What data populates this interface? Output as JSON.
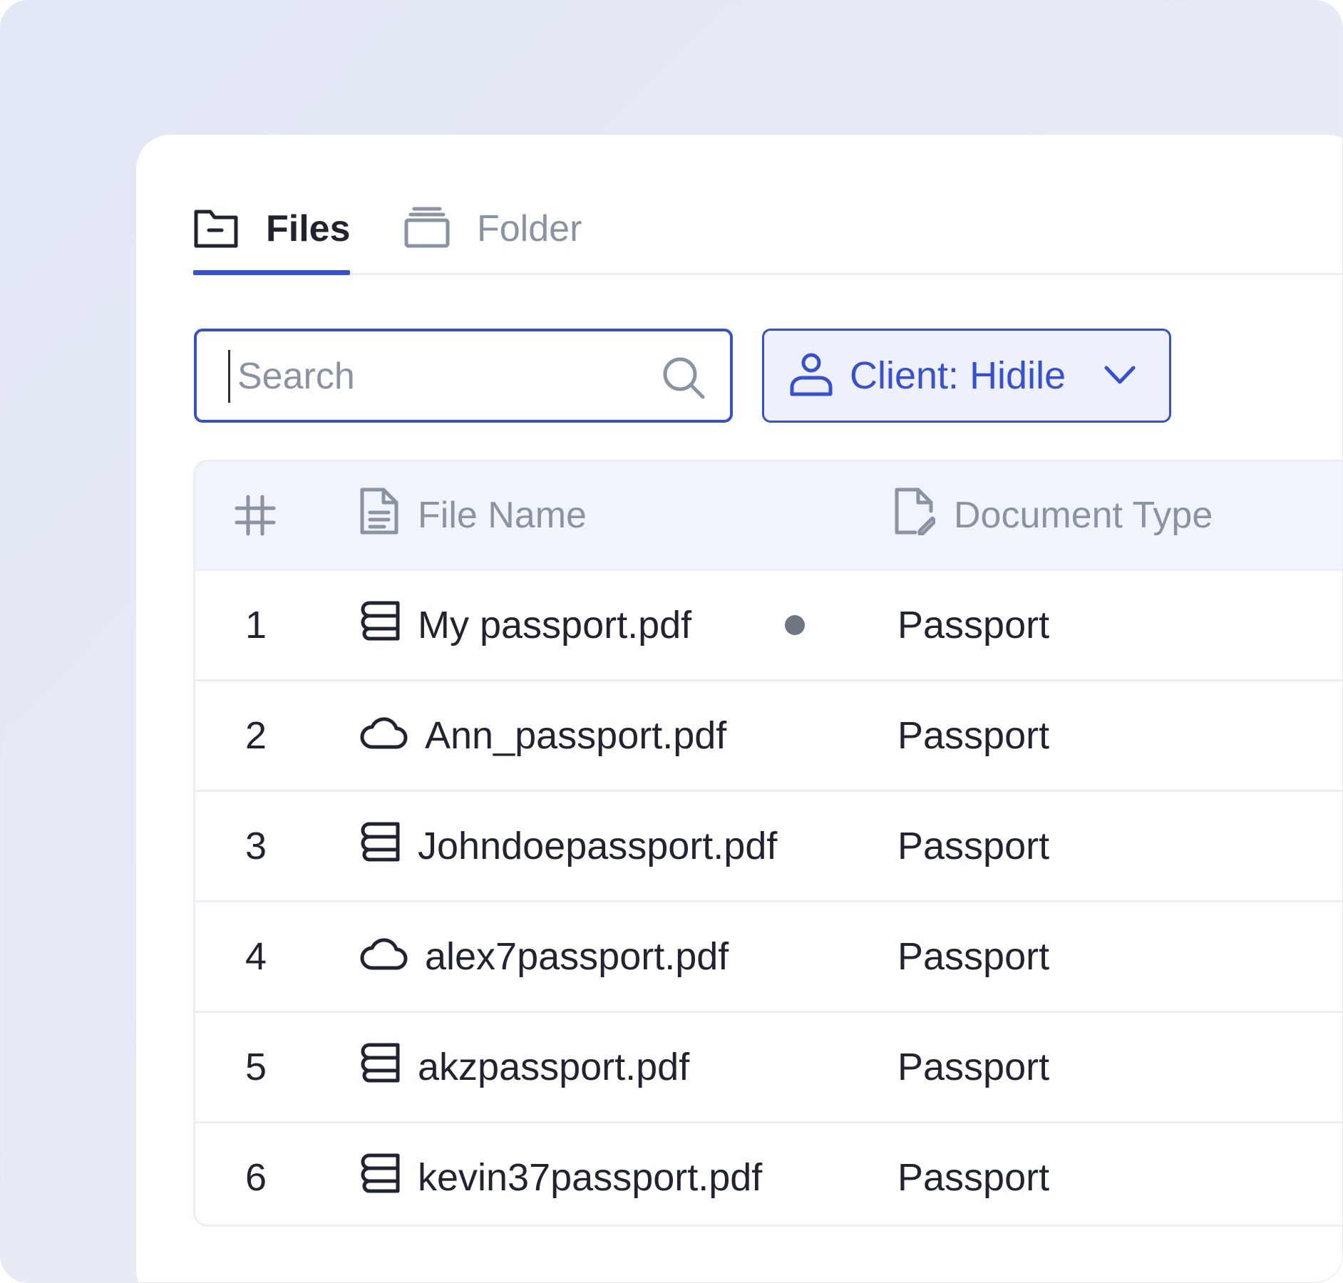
{
  "tabs": [
    {
      "label": "Files",
      "icon": "folder-icon",
      "active": true
    },
    {
      "label": "Folder",
      "icon": "stack-icon",
      "active": false
    }
  ],
  "search": {
    "placeholder": "Search",
    "value": ""
  },
  "client_filter": {
    "label": "Client: Hidile"
  },
  "table": {
    "headers": {
      "num": "#",
      "file_name": "File Name",
      "document_type": "Document Type"
    },
    "rows": [
      {
        "num": "1",
        "file_name": "My passport.pdf",
        "document_type": "Passport",
        "source_icon": "storage-icon",
        "status_dot": true
      },
      {
        "num": "2",
        "file_name": "Ann_passport.pdf",
        "document_type": "Passport",
        "source_icon": "cloud-icon",
        "status_dot": false
      },
      {
        "num": "3",
        "file_name": "Johndoepassport.pdf",
        "document_type": "Passport",
        "source_icon": "storage-icon",
        "status_dot": false
      },
      {
        "num": "4",
        "file_name": "alex7passport.pdf",
        "document_type": "Passport",
        "source_icon": "cloud-icon",
        "status_dot": false
      },
      {
        "num": "5",
        "file_name": "akzpassport.pdf",
        "document_type": "Passport",
        "source_icon": "storage-icon",
        "status_dot": false
      },
      {
        "num": "6",
        "file_name": "kevin37passport.pdf",
        "document_type": "Passport",
        "source_icon": "storage-icon",
        "status_dot": false
      }
    ]
  },
  "colors": {
    "accent": "#3550d4",
    "text": "#1f2430",
    "muted": "#8a93a3",
    "header_bg": "#f1f4fa",
    "dot": "#6f7682"
  }
}
